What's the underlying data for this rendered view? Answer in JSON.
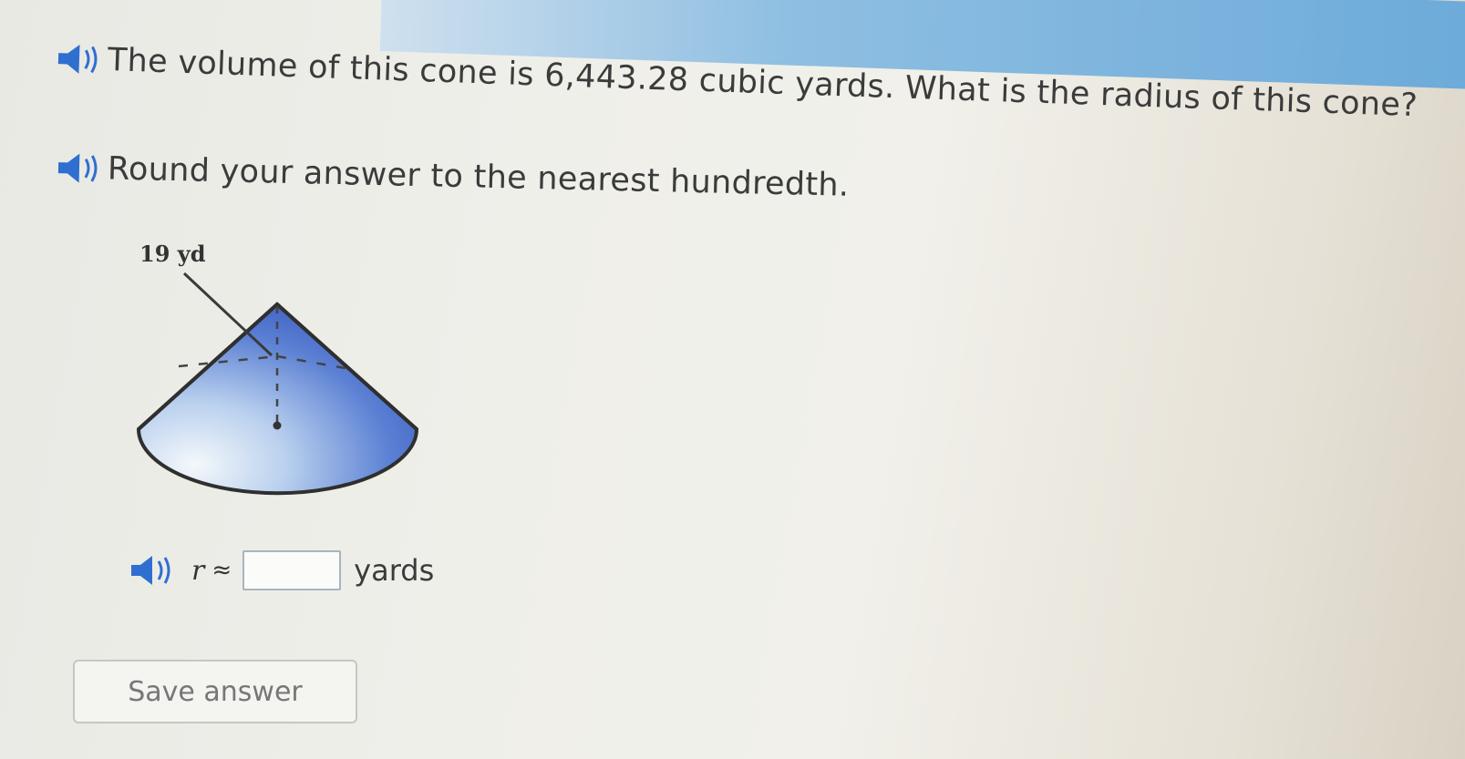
{
  "question": {
    "line1": "The volume of this cone is 6,443.28 cubic yards. What is the radius of this cone?",
    "line2": "Round your answer to the nearest hundredth."
  },
  "figure": {
    "slant_label": "19 yd"
  },
  "answer": {
    "variable": "r",
    "approx_symbol": "≈",
    "value": "",
    "unit": "yards"
  },
  "save_button": "Save answer",
  "colors": {
    "cone_dark": "#3f63c6",
    "cone_light": "#dbe8f4",
    "speaker_blue": "#2f6fd0",
    "header_blue": "#6aa9d9"
  },
  "icons": [
    "speaker-icon"
  ]
}
